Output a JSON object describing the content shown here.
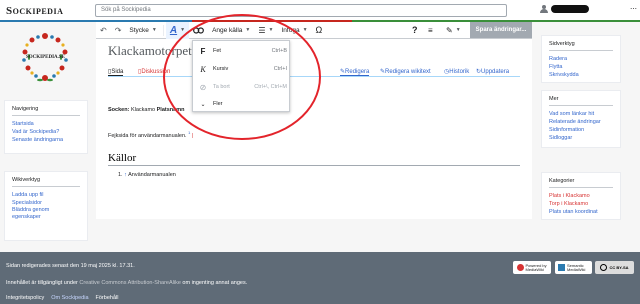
{
  "header": {
    "brand": "Sockipedia",
    "search_placeholder": "Sök på Sockipedia"
  },
  "toolbar": {
    "style_label": "Stycke",
    "cite_label": "Ange källa",
    "insert_label": "Infoga",
    "save_label": "Spara ändringar..."
  },
  "logo": {
    "text": "SOCKIPEDIA.SE"
  },
  "nav_panel": {
    "title": "Navigering",
    "items": [
      "Startsida",
      "Vad är Sockipedia?",
      "Senaste ändringarna"
    ]
  },
  "tools_panel": {
    "title": "Wikiverktyg",
    "items": [
      "Ladda upp fil",
      "Specialsidor",
      "Bläddra genom egenskaper"
    ]
  },
  "page": {
    "title": "Klackamotorpet",
    "tabs": {
      "page": "Sida",
      "talk": "Diskussion",
      "edit": "Redigera",
      "edit_source": "Redigera wikitext",
      "history": "Historik",
      "update": "Uppdatera"
    },
    "socken_label": "Socken:",
    "socken_value": "Klackamo",
    "platsnamn_label": "Platsnamn",
    "body_line": "Fejksida för användarmanualen.",
    "footnote_marker": "1",
    "refs_heading": "Källor",
    "ref_number": "1.",
    "ref_arrow": "↑",
    "ref_text": "Användarmanualen"
  },
  "dropdown": {
    "items": [
      {
        "label": "Fet",
        "shortcut": "Ctrl+B",
        "icon": "bold-icon",
        "enabled": true
      },
      {
        "label": "Kursiv",
        "shortcut": "Ctrl+I",
        "icon": "italic-icon",
        "enabled": true
      },
      {
        "label": "Ta bort",
        "shortcut": "Ctrl+\\, Ctrl+M",
        "icon": "clear-format-icon",
        "enabled": false
      },
      {
        "label": "Fler",
        "shortcut": "",
        "icon": "chevron-down-icon",
        "enabled": true
      }
    ]
  },
  "right_panels": {
    "tools": {
      "title": "Sidverktyg",
      "items": [
        "Radera",
        "Flytta",
        "Skrivskydda"
      ]
    },
    "more": {
      "title": "Mer",
      "items": [
        "Vad som länkar hit",
        "Relaterade ändringar",
        "Sidinformation",
        "Sidloggar"
      ]
    },
    "categories": {
      "title": "Kategorier",
      "items": [
        "Plats i Klackamo",
        "Torp i Klackamo",
        "Plats utan koordinat"
      ]
    }
  },
  "footer": {
    "last_edited": "Sidan redigerades senast den 19 maj 2025 kl. 17.31.",
    "license_prefix": "Innehållet är tillgängligt under",
    "license_link": "Creative Commons Attribution-ShareAlike",
    "license_suffix": "om ingenting annat anges.",
    "links": [
      "Integritetspolicy",
      "Om Sockipedia",
      "Förbehåll"
    ],
    "badge_mediawiki": "Powered by MediaWiki",
    "badge_semantic": "Semantic MediaWiki",
    "badge_cc": "CC BY-SA"
  },
  "colors": {
    "link": "#3366cc",
    "redlink": "#d73333",
    "footer_bg": "#5f6b77",
    "highlight_ring": "#e3242b"
  }
}
